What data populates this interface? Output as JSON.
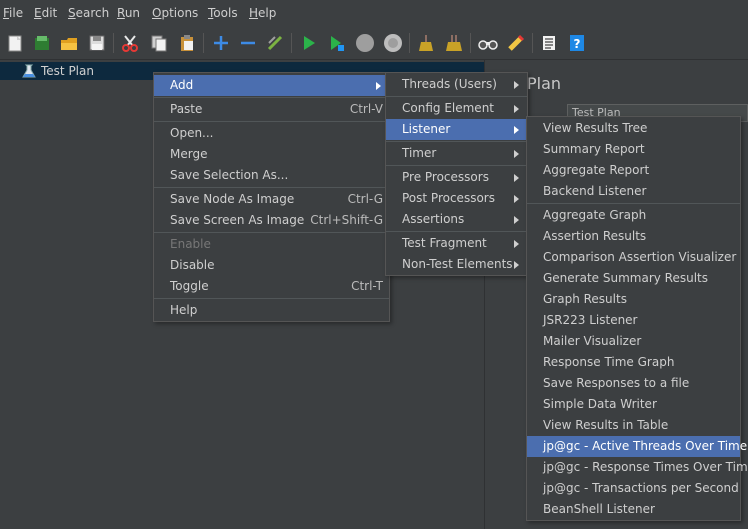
{
  "menubar": [
    "File",
    "Edit",
    "Search",
    "Run",
    "Options",
    "Tools",
    "Help"
  ],
  "toolbar_icons": [
    "new-icon",
    "templates-icon",
    "open-icon",
    "save-icon",
    "cut-icon",
    "copy-icon",
    "paste-icon",
    "expand-icon",
    "collapse-icon",
    "toggle-icon",
    "start-icon",
    "start-no-pauses-icon",
    "stop-icon",
    "shutdown-icon",
    "clear-icon",
    "clear-all-icon",
    "search-icon",
    "reset-search-icon",
    "function-helper-icon",
    "help-icon"
  ],
  "tree": {
    "root_label": "Test Plan"
  },
  "right_panel": {
    "title": "Plan",
    "name_value": "Test Plan"
  },
  "context_menu": {
    "items": [
      {
        "label": "Add",
        "accel": "",
        "submenu": true
      },
      {
        "label": "Paste",
        "accel": "Ctrl-V"
      },
      {
        "label": "Open...",
        "accel": ""
      },
      {
        "label": "Merge",
        "accel": ""
      },
      {
        "label": "Save Selection As...",
        "accel": ""
      },
      {
        "label": "Save Node As Image",
        "accel": "Ctrl-G"
      },
      {
        "label": "Save Screen As Image",
        "accel": "Ctrl+Shift-G"
      },
      {
        "label": "Enable",
        "accel": "",
        "disabled": true
      },
      {
        "label": "Disable",
        "accel": ""
      },
      {
        "label": "Toggle",
        "accel": "Ctrl-T"
      },
      {
        "label": "Help",
        "accel": ""
      }
    ]
  },
  "add_submenu": {
    "items": [
      {
        "label": "Threads (Users)"
      },
      {
        "label": "Config Element"
      },
      {
        "label": "Listener"
      },
      {
        "label": "Timer"
      },
      {
        "label": "Pre Processors"
      },
      {
        "label": "Post Processors"
      },
      {
        "label": "Assertions"
      },
      {
        "label": "Test Fragment"
      },
      {
        "label": "Non-Test Elements"
      }
    ]
  },
  "listener_submenu": {
    "items": [
      "View Results Tree",
      "Summary Report",
      "Aggregate Report",
      "Backend Listener",
      "Aggregate Graph",
      "Assertion Results",
      "Comparison Assertion Visualizer",
      "Generate Summary Results",
      "Graph Results",
      "JSR223 Listener",
      "Mailer Visualizer",
      "Response Time Graph",
      "Save Responses to a file",
      "Simple Data Writer",
      "View Results in Table",
      "jp@gc - Active Threads Over Time",
      "jp@gc - Response Times Over Time",
      "jp@gc - Transactions per Second",
      "BeanShell Listener"
    ]
  }
}
